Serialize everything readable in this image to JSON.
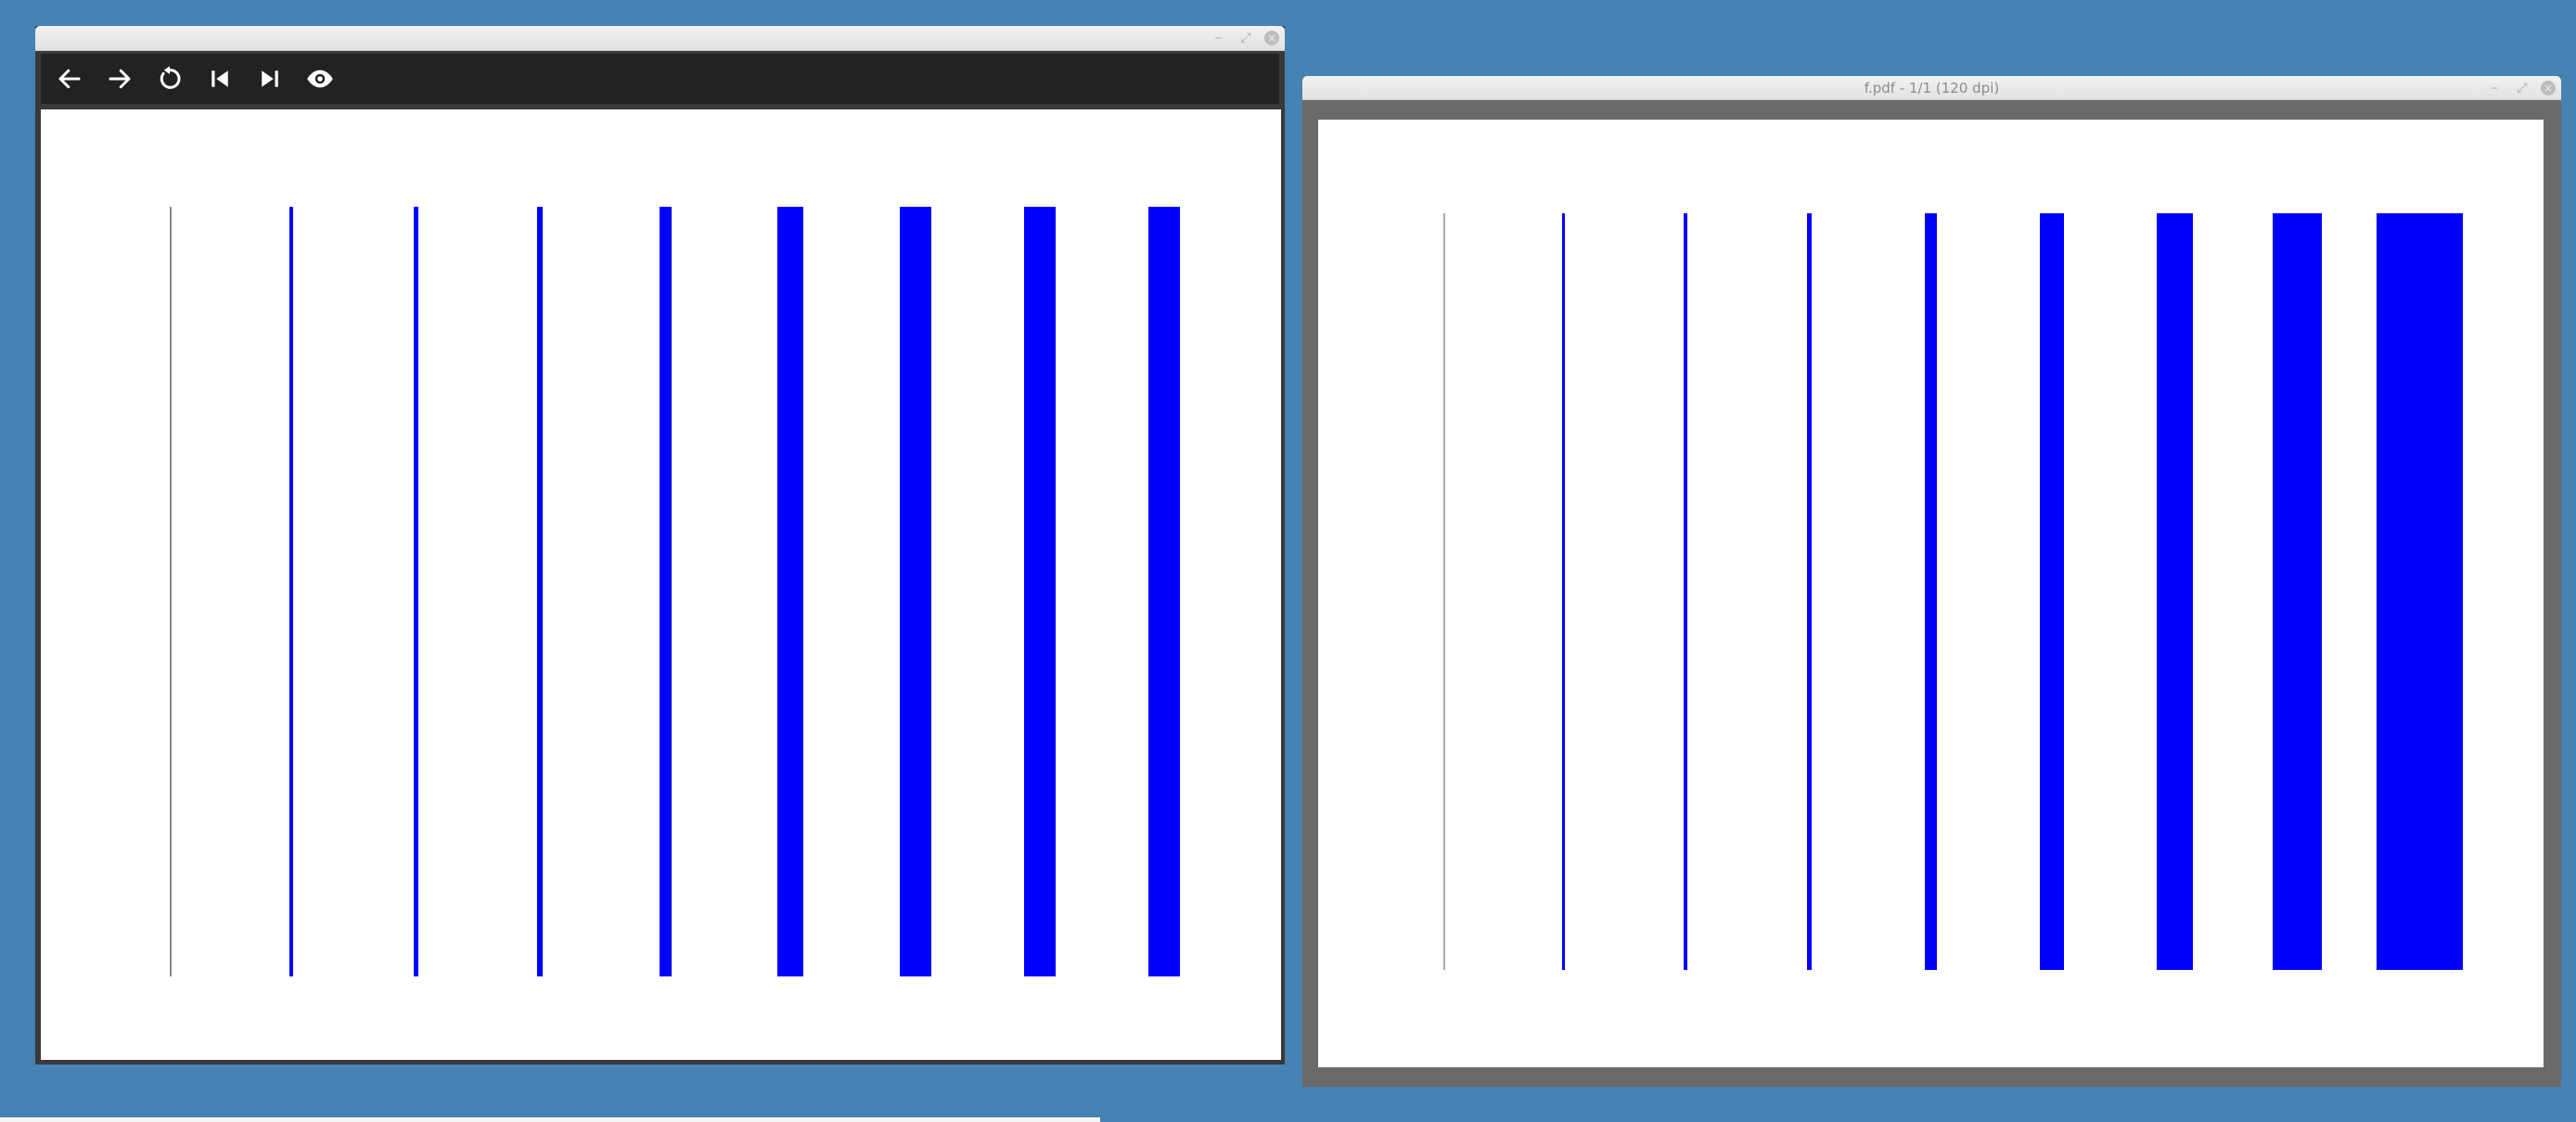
{
  "viewer_left": {
    "title": "",
    "toolbar": {
      "back": "arrow-left-icon",
      "forward": "arrow-right-icon",
      "reload": "reload-icon",
      "first": "skip-first-icon",
      "last": "skip-last-icon",
      "view": "eye-icon"
    },
    "window_buttons": {
      "minimize": "–",
      "maximize": "⤢",
      "close": "×"
    }
  },
  "viewer_right": {
    "title": "f.pdf - 1/1 (120 dpi)",
    "window_buttons": {
      "minimize": "–",
      "maximize": "⤢",
      "close": "×"
    }
  },
  "colors": {
    "bar": "#0000ff",
    "first_line": "#888888",
    "desktop": "#4682b4"
  }
}
